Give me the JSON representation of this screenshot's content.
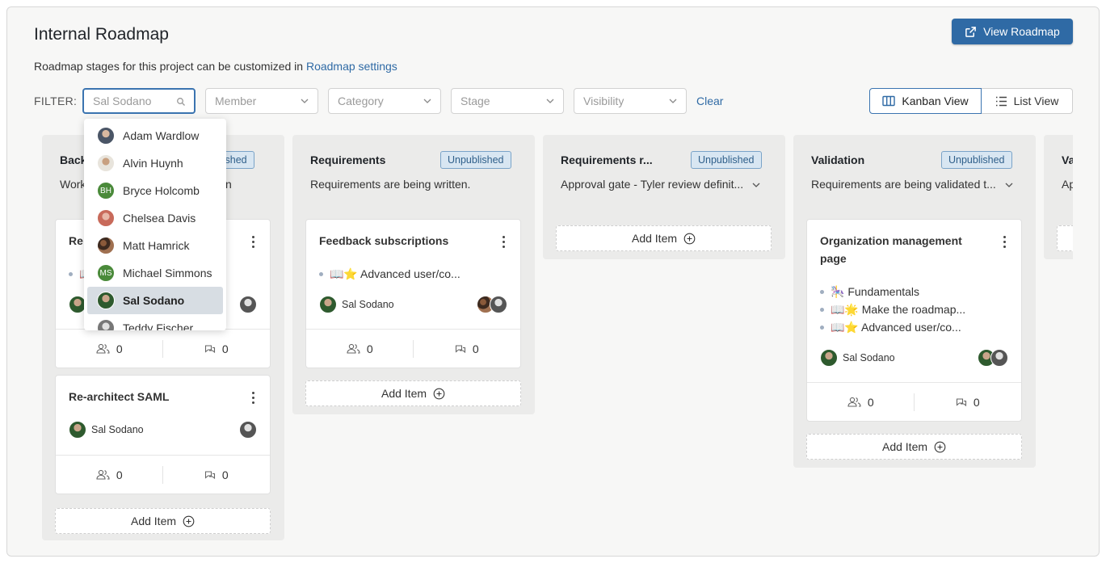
{
  "header": {
    "title": "Internal Roadmap",
    "view_button": "View Roadmap",
    "subtitle_prefix": "Roadmap stages for this project can be customized in ",
    "subtitle_link": "Roadmap settings"
  },
  "filters": {
    "label": "FILTER:",
    "search_placeholder": "Sal Sodano",
    "member": "Member",
    "category": "Category",
    "stage": "Stage",
    "visibility": "Visibility",
    "clear": "Clear"
  },
  "views": {
    "kanban": "Kanban View",
    "list": "List View"
  },
  "dropdown": {
    "options": [
      {
        "name": "Adam Wardlow",
        "avatar": "photo"
      },
      {
        "name": "Alvin Huynh",
        "avatar": "photo"
      },
      {
        "name": "Bryce Holcomb",
        "avatar": "BH"
      },
      {
        "name": "Chelsea Davis",
        "avatar": "photo"
      },
      {
        "name": "Matt Hamrick",
        "avatar": "photo"
      },
      {
        "name": "Michael Simmons",
        "avatar": "MS"
      },
      {
        "name": "Sal Sodano",
        "avatar": "photo",
        "selected": true
      },
      {
        "name": "Teddy Fischer",
        "avatar": "photo"
      }
    ]
  },
  "columns": [
    {
      "name": "Back",
      "badge": "Unpublished",
      "badge_visible": "blished",
      "description": "Work",
      "description_tail": "n",
      "cards": [
        {
          "title": "Re",
          "bullet": "📖",
          "owner": "Sal Sodano",
          "members": "0",
          "comments": "0"
        },
        {
          "title": "Re-architect SAML",
          "owner": "Sal Sodano",
          "members": "0",
          "comments": "0"
        }
      ],
      "add_item": "Add Item"
    },
    {
      "name": "Requirements",
      "badge": "Unpublished",
      "description": "Requirements are being written.",
      "cards": [
        {
          "title": "Feedback subscriptions",
          "bullets": [
            "📖⭐ Advanced user/co..."
          ],
          "owner": "Sal Sodano",
          "members": "0",
          "comments": "0"
        }
      ],
      "add_item": "Add Item"
    },
    {
      "name": "Requirements r...",
      "badge": "Unpublished",
      "description": "Approval gate - Tyler review definit...",
      "cards": [],
      "add_item": "Add Item"
    },
    {
      "name": "Validation",
      "badge": "Unpublished",
      "description": "Requirements are being validated t...",
      "cards": [
        {
          "title": "Organization management page",
          "bullets": [
            "🎠 Fundamentals",
            "📖🌟 Make the roadmap...",
            "📖⭐ Advanced user/co..."
          ],
          "owner": "Sal Sodano",
          "members": "0",
          "comments": "0"
        }
      ],
      "add_item": "Add Item"
    },
    {
      "name": "Va",
      "description": "Ap"
    }
  ],
  "colors": {
    "primary": "#2f6aa5",
    "badge_bg": "#d8e6f2",
    "column_bg": "#ebebea"
  }
}
